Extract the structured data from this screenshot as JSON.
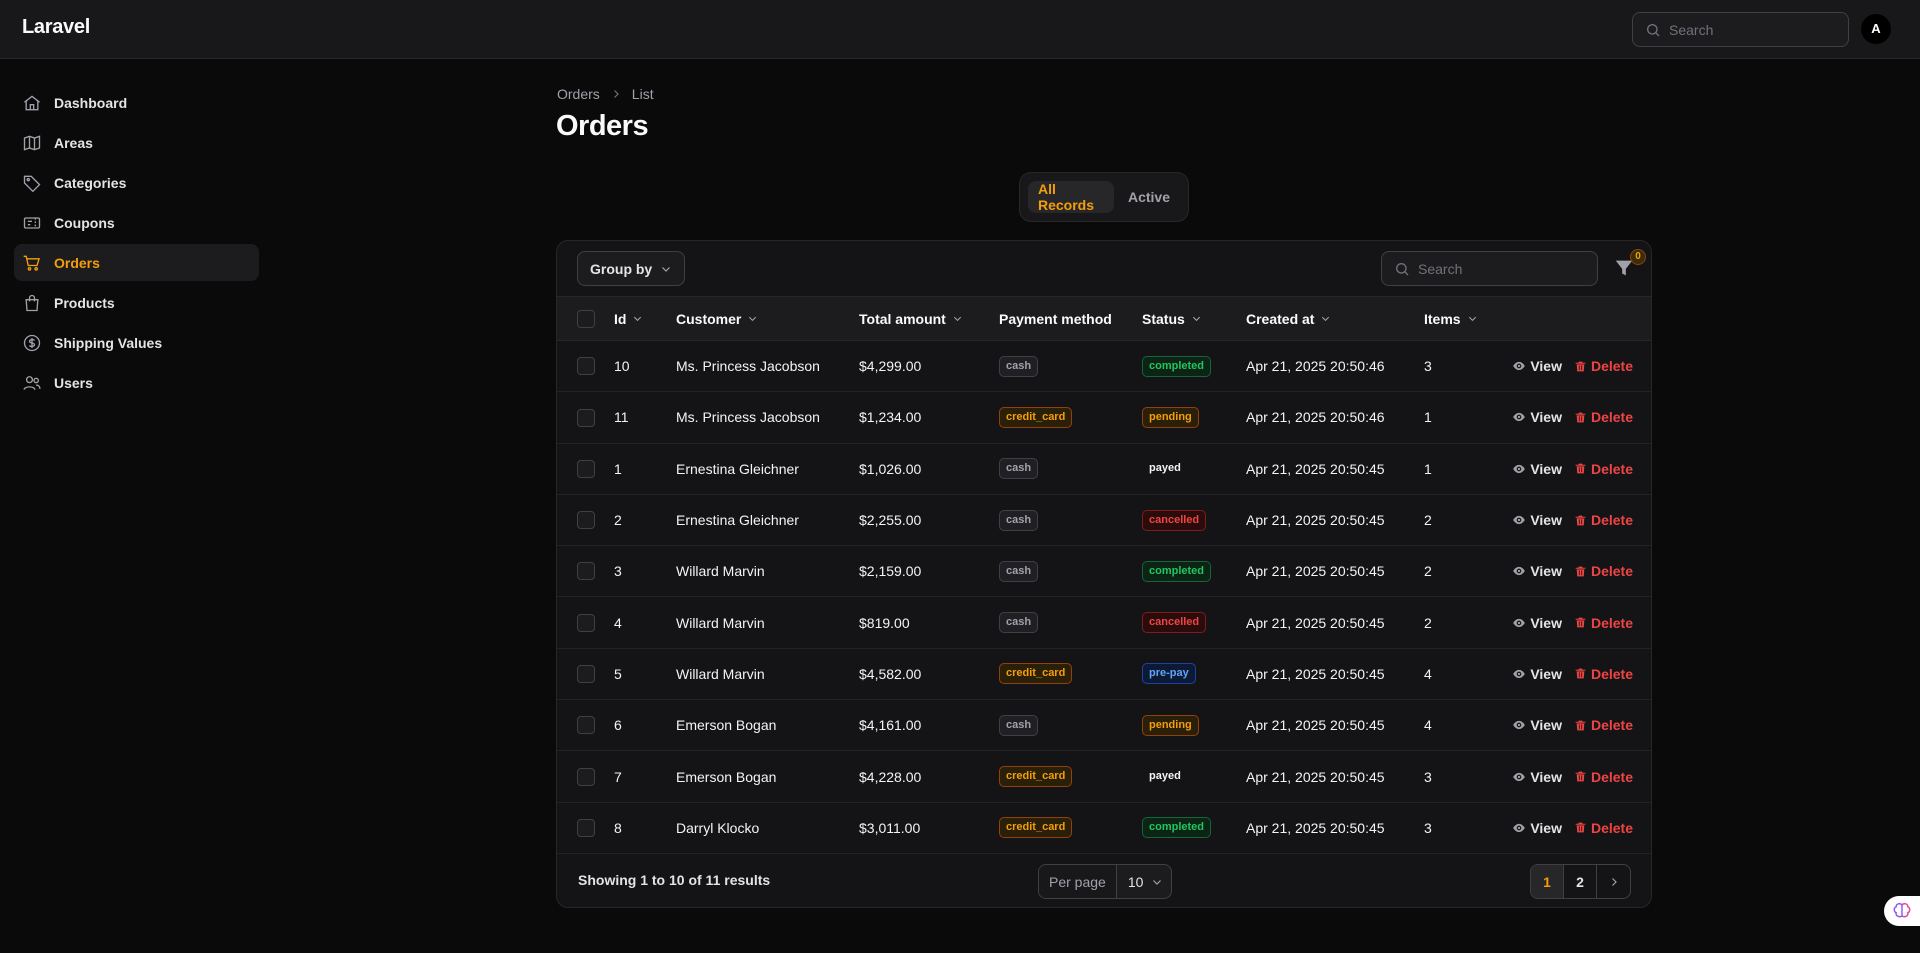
{
  "app": {
    "brand": "Laravel",
    "user_initial": "A"
  },
  "topbar": {
    "search_placeholder": "Search"
  },
  "sidebar": {
    "items": [
      {
        "label": "Dashboard",
        "icon": "home-icon"
      },
      {
        "label": "Areas",
        "icon": "map-icon"
      },
      {
        "label": "Categories",
        "icon": "tag-icon"
      },
      {
        "label": "Coupons",
        "icon": "ticket-icon"
      },
      {
        "label": "Orders",
        "icon": "cart-icon",
        "active": true
      },
      {
        "label": "Products",
        "icon": "bag-icon"
      },
      {
        "label": "Shipping Values",
        "icon": "dollar-icon"
      },
      {
        "label": "Users",
        "icon": "users-icon"
      }
    ]
  },
  "breadcrumb": {
    "parent": "Orders",
    "current": "List"
  },
  "page": {
    "title": "Orders"
  },
  "tabs": [
    {
      "label": "All Records",
      "active": true
    },
    {
      "label": "Active",
      "active": false
    }
  ],
  "toolbar": {
    "group_by": "Group by",
    "search_placeholder": "Search",
    "filter_count": "0"
  },
  "table": {
    "columns": [
      "Id",
      "Customer",
      "Total amount",
      "Payment method",
      "Status",
      "Created at",
      "Items"
    ],
    "rows": [
      {
        "id": "10",
        "customer": "Ms. Princess Jacobson",
        "amount": "$4,299.00",
        "payment": "cash",
        "status": "completed",
        "created": "Apr 21, 2025 20:50:46",
        "items": "3"
      },
      {
        "id": "11",
        "customer": "Ms. Princess Jacobson",
        "amount": "$1,234.00",
        "payment": "credit_card",
        "status": "pending",
        "created": "Apr 21, 2025 20:50:46",
        "items": "1"
      },
      {
        "id": "1",
        "customer": "Ernestina Gleichner",
        "amount": "$1,026.00",
        "payment": "cash",
        "status": "payed",
        "created": "Apr 21, 2025 20:50:45",
        "items": "1"
      },
      {
        "id": "2",
        "customer": "Ernestina Gleichner",
        "amount": "$2,255.00",
        "payment": "cash",
        "status": "cancelled",
        "created": "Apr 21, 2025 20:50:45",
        "items": "2"
      },
      {
        "id": "3",
        "customer": "Willard Marvin",
        "amount": "$2,159.00",
        "payment": "cash",
        "status": "completed",
        "created": "Apr 21, 2025 20:50:45",
        "items": "2"
      },
      {
        "id": "4",
        "customer": "Willard Marvin",
        "amount": "$819.00",
        "payment": "cash",
        "status": "cancelled",
        "created": "Apr 21, 2025 20:50:45",
        "items": "2"
      },
      {
        "id": "5",
        "customer": "Willard Marvin",
        "amount": "$4,582.00",
        "payment": "credit_card",
        "status": "pre-pay",
        "created": "Apr 21, 2025 20:50:45",
        "items": "4"
      },
      {
        "id": "6",
        "customer": "Emerson Bogan",
        "amount": "$4,161.00",
        "payment": "cash",
        "status": "pending",
        "created": "Apr 21, 2025 20:50:45",
        "items": "4"
      },
      {
        "id": "7",
        "customer": "Emerson Bogan",
        "amount": "$4,228.00",
        "payment": "credit_card",
        "status": "payed",
        "created": "Apr 21, 2025 20:50:45",
        "items": "3"
      },
      {
        "id": "8",
        "customer": "Darryl Klocko",
        "amount": "$3,011.00",
        "payment": "credit_card",
        "status": "completed",
        "created": "Apr 21, 2025 20:50:45",
        "items": "3"
      }
    ],
    "actions": {
      "view": "View",
      "delete": "Delete"
    }
  },
  "footer": {
    "summary": "Showing 1 to 10 of 11 results",
    "per_page_label": "Per page",
    "per_page_value": "10",
    "pages": [
      "1",
      "2"
    ],
    "current_page": "1"
  }
}
